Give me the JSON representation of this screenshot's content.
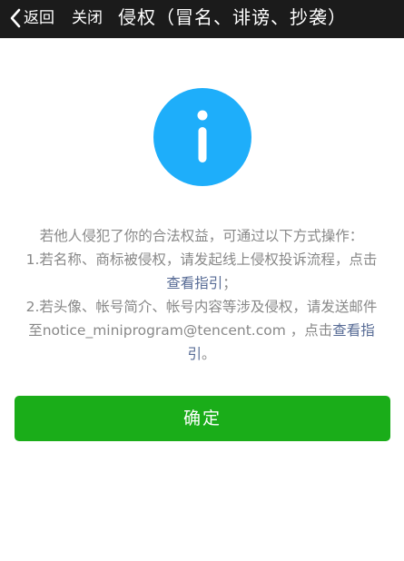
{
  "header": {
    "back_label": "返回",
    "close_label": "关闭",
    "title": "侵权（冒名、诽谤、抄袭）"
  },
  "icons": {
    "back": "chevron-left-icon",
    "info": "info-circle-icon"
  },
  "colors": {
    "header_bg": "#1b1b1b",
    "info_icon": "#1eaefa",
    "link": "#576b95",
    "button": "#1aad19",
    "body_text": "#888888"
  },
  "message": {
    "intro": "若他人侵犯了你的合法权益，可通过以下方式操作：",
    "item1_text": "1.若名称、商标被侵权，请发起线上侵权投诉流程，点击",
    "item1_link": "查看指引",
    "item1_end": "；",
    "item2_text": "2.若头像、帐号简介、帐号内容等涉及侵权，请发送邮件至notice_miniprogram@tencent.com ，点击",
    "item2_link": "查看指引",
    "item2_end": "。"
  },
  "confirm_label": "确定"
}
